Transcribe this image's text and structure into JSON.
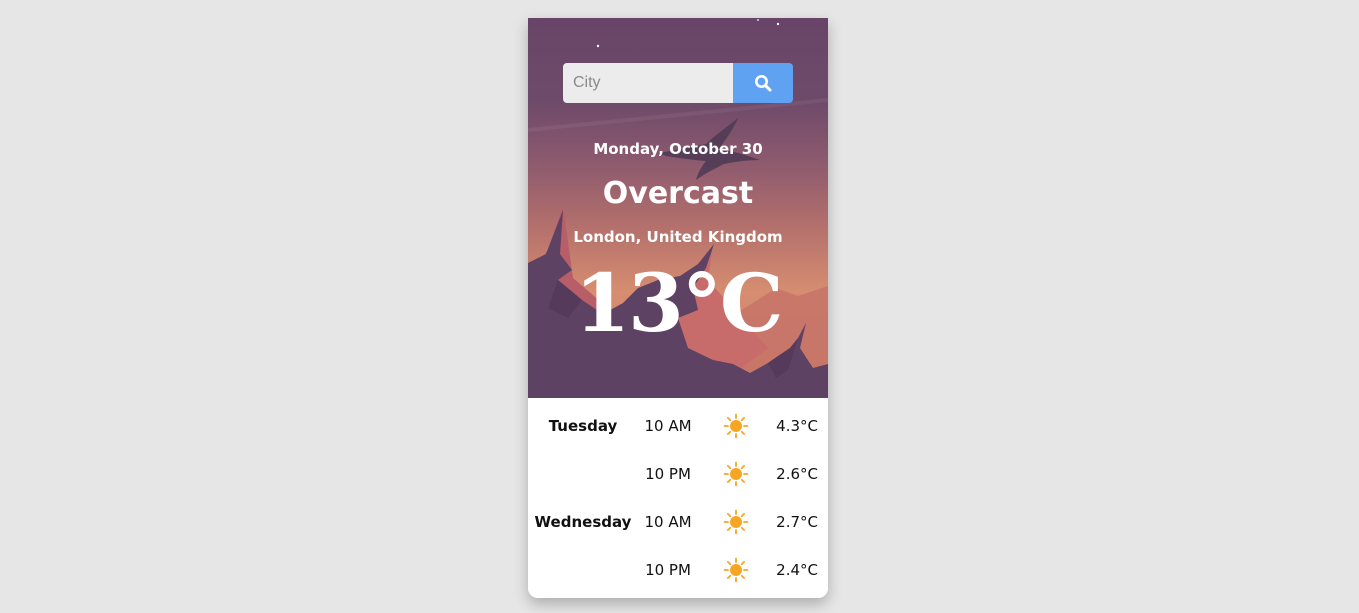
{
  "search": {
    "placeholder": "City",
    "button_icon": "search-icon"
  },
  "current": {
    "date": "Monday, October 30",
    "condition": "Overcast",
    "location": "London, United Kingdom",
    "temperature": "13°C"
  },
  "forecast": [
    {
      "day": "Tuesday",
      "time": "10 AM",
      "icon": "sun-icon",
      "temp": "4.3°C"
    },
    {
      "day": "",
      "time": "10 PM",
      "icon": "sun-icon",
      "temp": "2.6°C"
    },
    {
      "day": "Wednesday",
      "time": "10 AM",
      "icon": "sun-icon",
      "temp": "2.7°C"
    },
    {
      "day": "",
      "time": "10 PM",
      "icon": "sun-icon",
      "temp": "2.4°C"
    }
  ],
  "colors": {
    "accent": "#5fa2f2",
    "sun": "#f5a623",
    "sky_top": "#684468",
    "sky_bottom": "#d68d70",
    "mountain": "#5e4263"
  }
}
